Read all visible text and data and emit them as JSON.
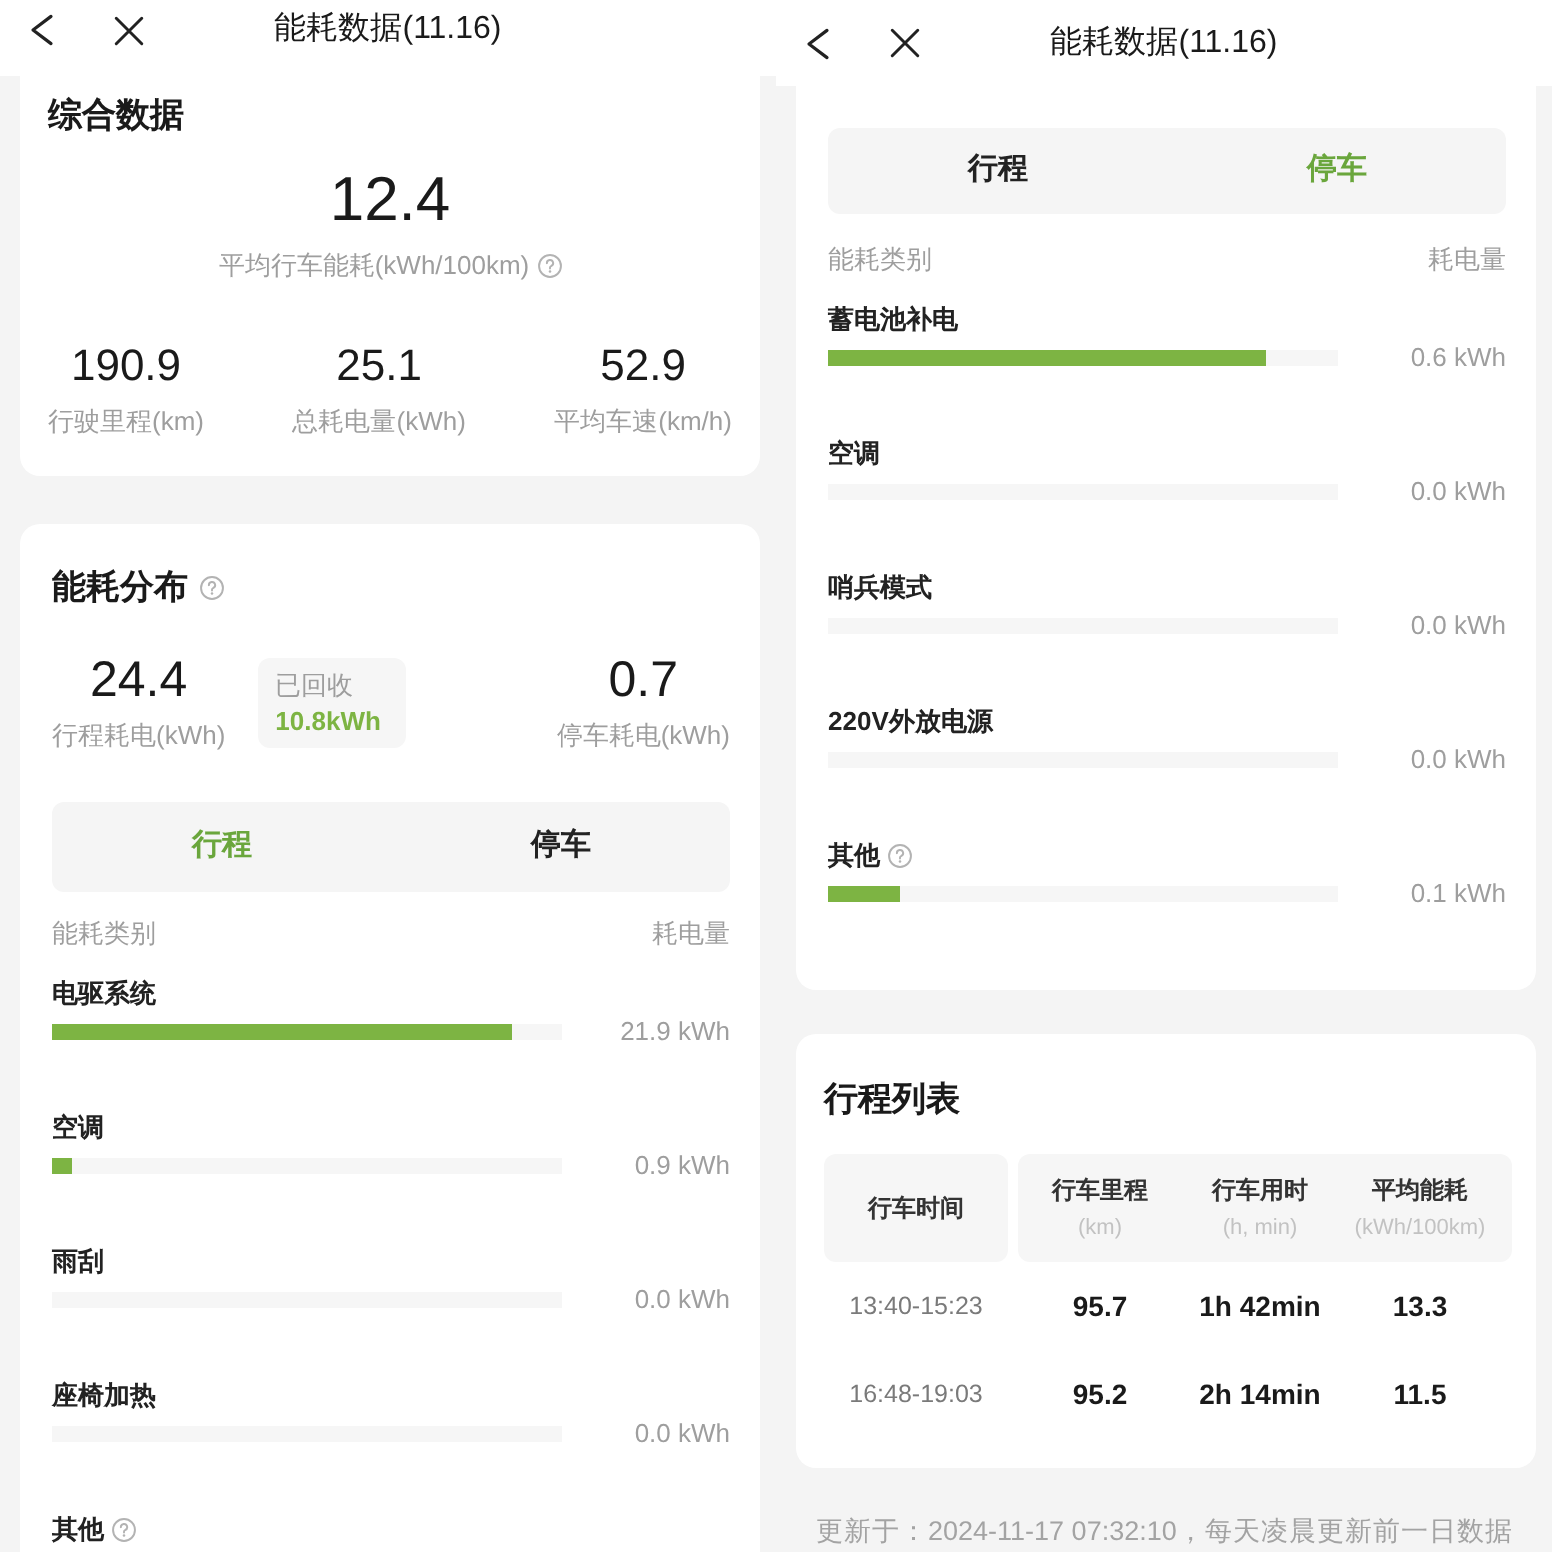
{
  "left_screen": {
    "nav": {
      "title": "能耗数据(11.16)"
    },
    "summary_card": {
      "title": "综合数据",
      "main_value": "12.4",
      "main_label": "平均行车能耗(kWh/100km)",
      "main_label_help": true,
      "stats": [
        {
          "value": "190.9",
          "label": "行驶里程(km)"
        },
        {
          "value": "25.1",
          "label": "总耗电量(kWh)"
        },
        {
          "value": "52.9",
          "label": "平均车速(km/h)"
        }
      ]
    },
    "distribution_card": {
      "title": "能耗分布",
      "title_help": true,
      "trip_energy": {
        "value": "24.4",
        "label": "行程耗电(kWh)"
      },
      "recovered": {
        "label": "已回收",
        "value": "10.8kWh"
      },
      "parking_energy": {
        "value": "0.7",
        "label": "停车耗电(kWh)"
      },
      "tabs": [
        {
          "label": "行程",
          "selected": true
        },
        {
          "label": "停车",
          "selected": false
        }
      ],
      "columns": [
        "能耗类别",
        "耗电量"
      ],
      "items": [
        {
          "label": "电驱系统",
          "help": false,
          "level": 0.9,
          "value": "21.9 kWh"
        },
        {
          "label": "空调",
          "help": false,
          "level": 0.04,
          "value": "0.9 kWh"
        },
        {
          "label": "雨刮",
          "help": false,
          "level": 0,
          "value": "0.0 kWh"
        },
        {
          "label": "座椅加热",
          "help": false,
          "level": 0,
          "value": "0.0 kWh"
        },
        {
          "label": "其他",
          "help": true
        }
      ]
    }
  },
  "right_screen": {
    "nav": {
      "title": "能耗数据(11.16)"
    },
    "distribution_card": {
      "tabs": [
        {
          "label": "行程",
          "selected": false
        },
        {
          "label": "停车",
          "selected": true
        }
      ],
      "columns": [
        "能耗类别",
        "耗电量"
      ],
      "items": [
        {
          "label": "蓄电池补电",
          "help": false,
          "level": 0.86,
          "value": "0.6 kWh"
        },
        {
          "label": "空调",
          "help": false,
          "level": 0,
          "value": "0.0 kWh"
        },
        {
          "label": "哨兵模式",
          "help": false,
          "level": 0,
          "value": "0.0 kWh"
        },
        {
          "label": "220V外放电源",
          "help": false,
          "level": 0,
          "value": "0.0 kWh"
        },
        {
          "label": "其他",
          "help": true,
          "level": 0.14,
          "value": "0.1 kWh"
        }
      ]
    },
    "trip_list": {
      "title": "行程列表",
      "columns": [
        {
          "label": "行车时间"
        },
        {
          "label": "行车里程",
          "unit": "(km)"
        },
        {
          "label": "行车用时",
          "unit": "(h, min)"
        },
        {
          "label": "平均能耗",
          "unit": "(kWh/100km)"
        }
      ],
      "rows": [
        {
          "cells": [
            "13:40-15:23",
            "95.7",
            "1h 42min",
            "13.3"
          ]
        },
        {
          "cells": [
            "16:48-19:03",
            "95.2",
            "2h 14min",
            "11.5"
          ]
        }
      ]
    },
    "update_note": "更新于：2024-11-17 07:32:10，每天凌晨更新前一日数据"
  }
}
